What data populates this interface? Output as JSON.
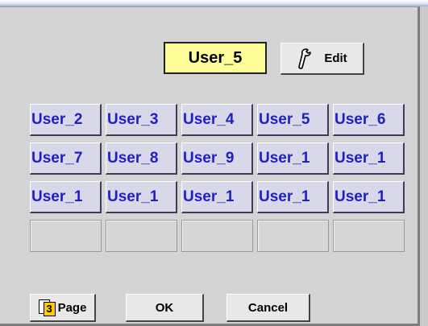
{
  "header": {
    "current_user": "User_5",
    "edit_label": "Edit"
  },
  "grid": {
    "rows": [
      [
        "User_2",
        "User_3",
        "User_4",
        "User_5",
        "User_6"
      ],
      [
        "User_7",
        "User_8",
        "User_9",
        "User_1",
        "User_1"
      ],
      [
        "User_1",
        "User_1",
        "User_1",
        "User_1",
        "User_1"
      ],
      [
        "",
        "",
        "",
        "",
        ""
      ]
    ]
  },
  "footer": {
    "page_number": "3",
    "page_label": "Page",
    "ok_label": "OK",
    "cancel_label": "Cancel"
  },
  "colors": {
    "current_bg": "#ffff99",
    "user_text": "#1f1fc8",
    "panel_bg": "#d4d4d4"
  },
  "icons": {
    "edit": "wrench-icon",
    "page": "page-icon"
  }
}
